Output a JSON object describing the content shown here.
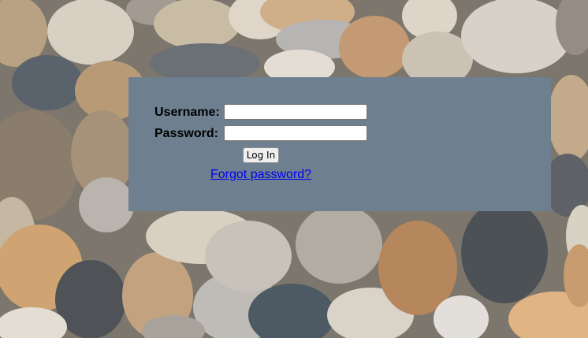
{
  "login": {
    "username_label": "Username:",
    "username_value": "",
    "password_label": "Password:",
    "password_value": "",
    "login_button": "Log In",
    "forgot_link": "Forgot password?"
  },
  "colors": {
    "panel_background": "#6e7f90",
    "link": "#0000ee"
  },
  "background": {
    "description_icon": "pebble-stones-background"
  }
}
